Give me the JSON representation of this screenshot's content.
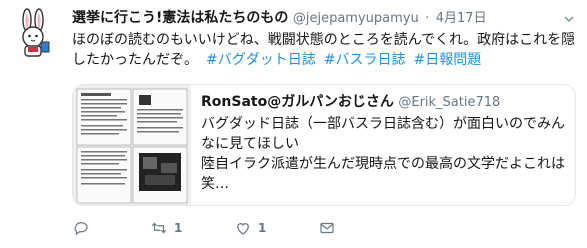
{
  "tweet": {
    "display_name": "選挙に行こう!憲法は私たちのもの",
    "handle": "@jejepamyupamyu",
    "separator": "·",
    "date": "4月17日",
    "text": "ほのぼの読むのもいいけどね、戦闘状態のところを読んでくれ。政府はこれを隠したかったんだぞ。",
    "hashtags": [
      "#バグダット日誌",
      "#バスラ日誌",
      "#日報問題"
    ]
  },
  "quote": {
    "display_name": "RonSato@ガルパンおじさん",
    "handle": "@Erik_Satie718",
    "text": "バグダッド日誌（一部バスラ日誌含む）が面白いのでみんなに見てほしい\n陸自イラク派遣が生んだ現時点での最高の文学だよこれは笑…"
  },
  "actions": {
    "reply_icon": "reply-icon",
    "retweet_icon": "retweet-icon",
    "retweet_count": "1",
    "like_icon": "heart-icon",
    "like_count": "1",
    "dm_icon": "envelope-icon"
  },
  "colors": {
    "link": "#1b95e0",
    "secondary": "#657786",
    "border": "#e1e8ed"
  }
}
